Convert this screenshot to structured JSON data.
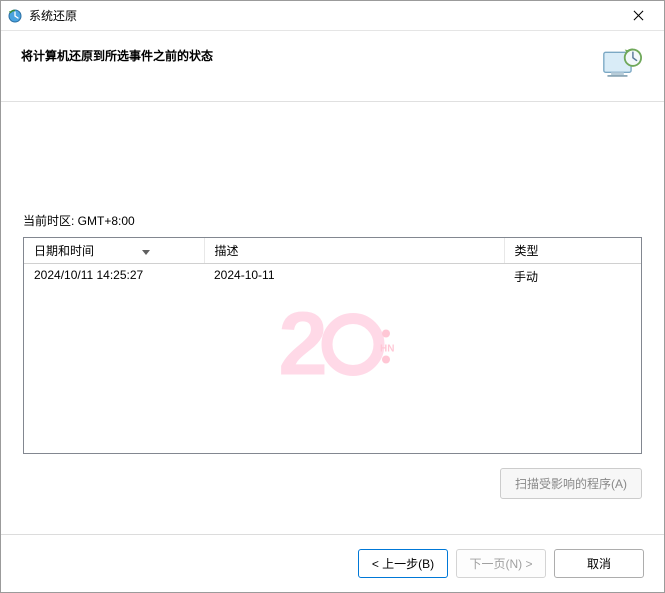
{
  "window": {
    "title": "系统还原"
  },
  "header": {
    "text": "将计算机还原到所选事件之前的状态"
  },
  "timezone": {
    "label": "当前时区: GMT+8:00"
  },
  "table": {
    "columns": {
      "date": "日期和时间",
      "desc": "描述",
      "type": "类型"
    },
    "rows": [
      {
        "date": "2024/10/11 14:25:27",
        "desc": "2024-10-11",
        "type": "手动"
      }
    ]
  },
  "buttons": {
    "scan": "扫描受影响的程序(A)",
    "back": "< 上一步(B)",
    "next": "下一页(N) >",
    "cancel": "取消"
  }
}
